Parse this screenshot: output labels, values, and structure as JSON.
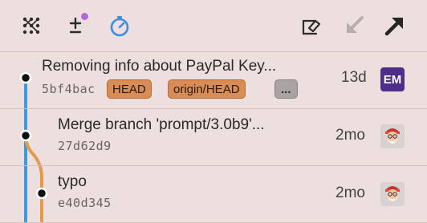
{
  "toolbar": {
    "icons": [
      "graph-grid-icon",
      "plus-minus-icon",
      "stopwatch-icon",
      "open-external-icon",
      "pull-arrow-icon",
      "push-arrow-icon"
    ],
    "accent": "#3a8ee6",
    "badge_color": "#b06ad6"
  },
  "commits": [
    {
      "message": "Removing info about PayPal Key...",
      "hash": "5bf4bac",
      "refs": [
        "HEAD",
        "origin/HEAD",
        "..."
      ],
      "age": "13d",
      "avatar": "EM"
    },
    {
      "message": "Merge branch 'prompt/3.0b9'...",
      "hash": "27d62d9",
      "refs": [],
      "age": "2mo",
      "avatar": "bearded-face-icon"
    },
    {
      "message": "typo",
      "hash": "e40d345",
      "refs": [],
      "age": "2mo",
      "avatar": "bearded-face-icon"
    }
  ],
  "colors": {
    "branch_main": "#3d9ad6",
    "branch_side": "#e39b4b",
    "tag_fill": "#d98d56",
    "tag_more_fill": "#a9a3a4"
  }
}
